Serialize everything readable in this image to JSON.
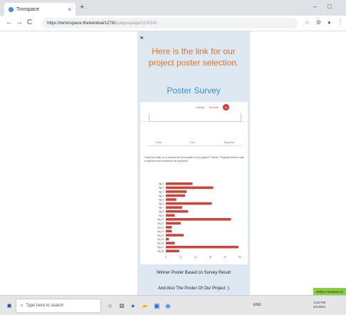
{
  "browser": {
    "tab_title": "Tinnspace",
    "tab_close": "×",
    "new_tab": "+",
    "minimize": "–",
    "maximize": "□",
    "url_host": "https://teminspace.theteknikal/12781",
    "url_path": "/pages/page/1120141",
    "back": "←",
    "forward": "→",
    "reload": "C",
    "lock": "🔒"
  },
  "page": {
    "heading": "Here is the link for our project poster selection.",
    "survey_title": "Poster Survey",
    "embed": {
      "tabs": [
        "Survey",
        "Results"
      ],
      "badge": "13",
      "scale_left": "Draft",
      "scale_mid": "Goo",
      "scale_right": "Beginner",
      "question": "Could you help us to choose the best poster of our project? Theme \"Projected lives in safe ecosphere environment to be prepared\""
    },
    "caption1": "Winner Poster Based on Survey Result",
    "caption2": "And Also The Poster Of Our Project :)",
    "online_members": "Online members (2"
  },
  "chart_data": {
    "type": "bar",
    "orientation": "horizontal",
    "categories": [
      "Mg 1",
      "Mg 2",
      "Mg 3",
      "Mg 4",
      "Mg 5",
      "Mg 6",
      "Mg 7",
      "Mg 8",
      "Mg 9",
      "Mg 10",
      "Mg 11",
      "Mg 12",
      "Mg 13",
      "Mg 14",
      "Mg 15",
      "Mg 16",
      "Mg 17",
      "Mg 18"
    ],
    "values": [
      18,
      32,
      14,
      13,
      7,
      31,
      11,
      15,
      6,
      44,
      10,
      4,
      4,
      12,
      2,
      6,
      49,
      9
    ],
    "xlim": [
      0,
      50
    ],
    "xticks": [
      "0",
      "10",
      "20",
      "30",
      "40",
      "50"
    ],
    "color": "#c9443a"
  },
  "taskbar": {
    "search_placeholder": "Type here to search",
    "tray": "ENG",
    "time": "4:23 PM",
    "date": "2/1/2021"
  }
}
